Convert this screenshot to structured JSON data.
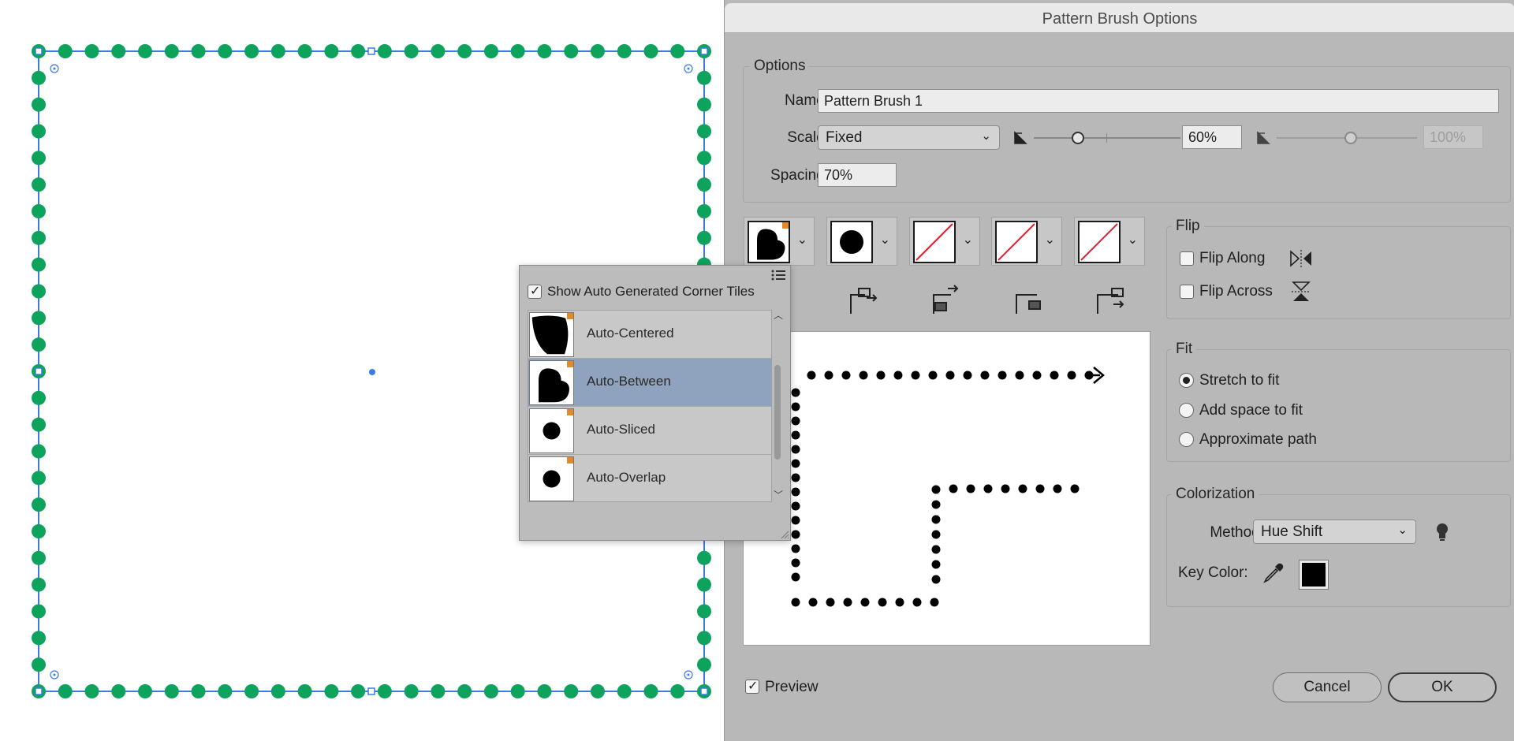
{
  "dialog": {
    "title": "Pattern Brush Options",
    "options_group": {
      "label": "Options",
      "name_label": "Name:",
      "name_value": "Pattern Brush 1",
      "scale_label": "Scale:",
      "scale_value": "Fixed",
      "scale_min_value": "60%",
      "scale_max_value": "100%",
      "spacing_label": "Spacing:",
      "spacing_value": "70%"
    },
    "tiles": [
      {
        "name": "outer-corner-tile",
        "shape": "leaf"
      },
      {
        "name": "side-tile",
        "shape": "circle"
      },
      {
        "name": "inner-corner-tile",
        "shape": "none"
      },
      {
        "name": "start-tile",
        "shape": "none"
      },
      {
        "name": "end-tile",
        "shape": "none"
      }
    ],
    "flip_group": {
      "label": "Flip",
      "flip_along_label": "Flip Along",
      "flip_along_checked": false,
      "flip_across_label": "Flip Across",
      "flip_across_checked": false
    },
    "fit_group": {
      "label": "Fit",
      "options": [
        "Stretch to fit",
        "Add space to fit",
        "Approximate path"
      ],
      "selected": "Stretch to fit"
    },
    "colorization_group": {
      "label": "Colorization",
      "method_label": "Method:",
      "method_value": "Hue Shift",
      "key_color_label": "Key Color:",
      "key_color": "#000000"
    },
    "preview_label": "Preview",
    "preview_checked": true,
    "cancel_label": "Cancel",
    "ok_label": "OK"
  },
  "corner_popup": {
    "checkbox_label": "Show Auto Generated Corner Tiles",
    "checkbox_checked": true,
    "items": [
      {
        "label": "Auto-Centered",
        "shape": "leaf-full",
        "selected": false
      },
      {
        "label": "Auto-Between",
        "shape": "leaf",
        "selected": true
      },
      {
        "label": "Auto-Sliced",
        "shape": "circle",
        "selected": false
      },
      {
        "label": "Auto-Overlap",
        "shape": "circle",
        "selected": false
      }
    ]
  },
  "colors": {
    "dot_green": "#0ea35c",
    "path_blue": "#3d7be0",
    "selected_row": "#8fa3be",
    "corner_marker": "#e08a2c",
    "tile_none_red": "#e0202e"
  }
}
